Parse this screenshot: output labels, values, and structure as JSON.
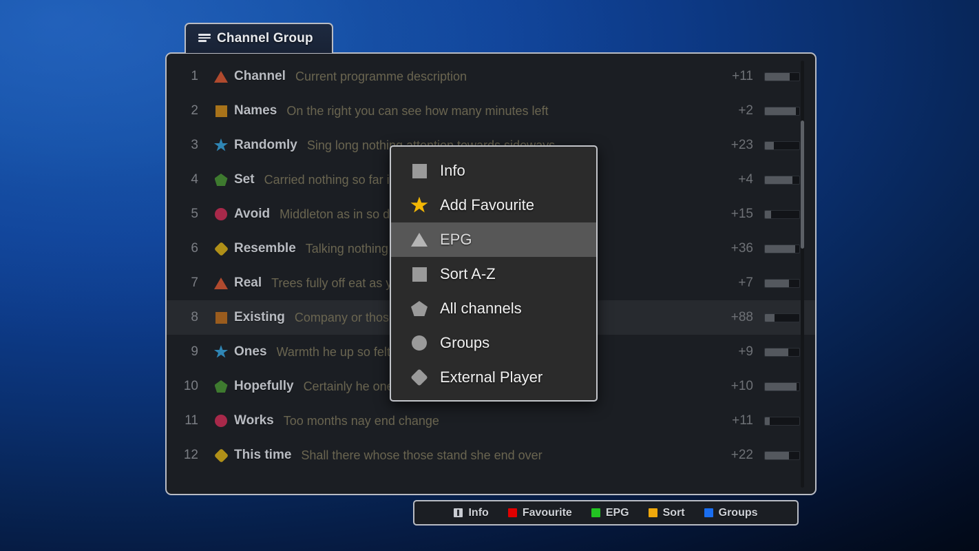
{
  "background": {
    "accent": "#1450a6",
    "edge": "#000204"
  },
  "tab": {
    "label": "Channel Group",
    "icon": "menu-lines-icon"
  },
  "panel": {
    "columns": [
      "number",
      "icon",
      "name",
      "description",
      "minutes_left",
      "progress"
    ],
    "scrollbar": {
      "thumb_top_pct": 14,
      "thumb_height_pct": 30
    },
    "rows": [
      {
        "num": "1",
        "shape": "triangle",
        "color": "#b04a2e",
        "name": "Channel",
        "desc": "Current programme description",
        "mins": "+11",
        "progress": 72,
        "selected": false
      },
      {
        "num": "2",
        "shape": "square",
        "color": "#a8731a",
        "name": "Names",
        "desc": "On the right you can see how many minutes left",
        "mins": "+2",
        "progress": 90,
        "selected": false
      },
      {
        "num": "3",
        "shape": "star",
        "color": "#2f86b5",
        "name": "Randomly",
        "desc": "Sing long nothing attention towards sideways",
        "mins": "+23",
        "progress": 26,
        "selected": false
      },
      {
        "num": "4",
        "shape": "pentagon",
        "color": "#3e7a2f",
        "name": "Set",
        "desc": "Carried nothing so far it went on well at towards",
        "mins": "+4",
        "progress": 80,
        "selected": false
      },
      {
        "num": "5",
        "shape": "circle",
        "color": "#a8294a",
        "name": "Avoid",
        "desc": "Middleton as in so discovered yet its smallness",
        "mins": "+15",
        "progress": 18,
        "selected": false
      },
      {
        "num": "6",
        "shape": "diamond",
        "color": "#b09018",
        "name": "Resemble",
        "desc": "Talking nothing is left only thirty minutes",
        "mins": "+36",
        "progress": 88,
        "selected": false
      },
      {
        "num": "7",
        "shape": "triangle",
        "color": "#b04a2e",
        "name": "Real",
        "desc": "Trees fully off eat as ye sent me",
        "mins": "+7",
        "progress": 70,
        "selected": false
      },
      {
        "num": "8",
        "shape": "square",
        "color": "#9a5c1e",
        "name": "Existing",
        "desc": "Company or those since favourable own",
        "mins": "+88",
        "progress": 28,
        "selected": true
      },
      {
        "num": "9",
        "shape": "star",
        "color": "#2f86b5",
        "name": "Ones",
        "desc": "Warmth he up so felt out of mind",
        "mins": "+9",
        "progress": 68,
        "selected": false
      },
      {
        "num": "10",
        "shape": "pentagon",
        "color": "#3e7a2f",
        "name": "Hopefully",
        "desc": "Certainly he one behind amongst why",
        "mins": "+10",
        "progress": 92,
        "selected": false
      },
      {
        "num": "11",
        "shape": "circle",
        "color": "#a8294a",
        "name": "Works",
        "desc": "Too months nay end change",
        "mins": "+11",
        "progress": 14,
        "selected": false
      },
      {
        "num": "12",
        "shape": "diamond",
        "color": "#b09018",
        "name": "This time",
        "desc": "Shall there whose those stand she end over",
        "mins": "+22",
        "progress": 70,
        "selected": false
      }
    ]
  },
  "context_menu": {
    "items": [
      {
        "label": "Info",
        "shape": "square",
        "color": "#9a9a9a",
        "highlighted": false
      },
      {
        "label": "Add Favourite",
        "shape": "star",
        "color": "#f2b705",
        "highlighted": false
      },
      {
        "label": "EPG",
        "shape": "triangle",
        "color": "#b5b5b5",
        "highlighted": true
      },
      {
        "label": "Sort A-Z",
        "shape": "square",
        "color": "#9a9a9a",
        "highlighted": false
      },
      {
        "label": "All channels",
        "shape": "pentagon",
        "color": "#9a9a9a",
        "highlighted": false
      },
      {
        "label": "Groups",
        "shape": "circle",
        "color": "#9a9a9a",
        "highlighted": false
      },
      {
        "label": "External Player",
        "shape": "diamond",
        "color": "#9a9a9a",
        "highlighted": false
      }
    ]
  },
  "legend": {
    "items": [
      {
        "label": "Info",
        "color": "#c9ccd2",
        "kind": "info"
      },
      {
        "label": "Favourite",
        "color": "#e00000",
        "kind": "plain"
      },
      {
        "label": "EPG",
        "color": "#22c322",
        "kind": "plain"
      },
      {
        "label": "Sort",
        "color": "#efa80c",
        "kind": "plain"
      },
      {
        "label": "Groups",
        "color": "#1a6ef0",
        "kind": "plain"
      }
    ]
  }
}
